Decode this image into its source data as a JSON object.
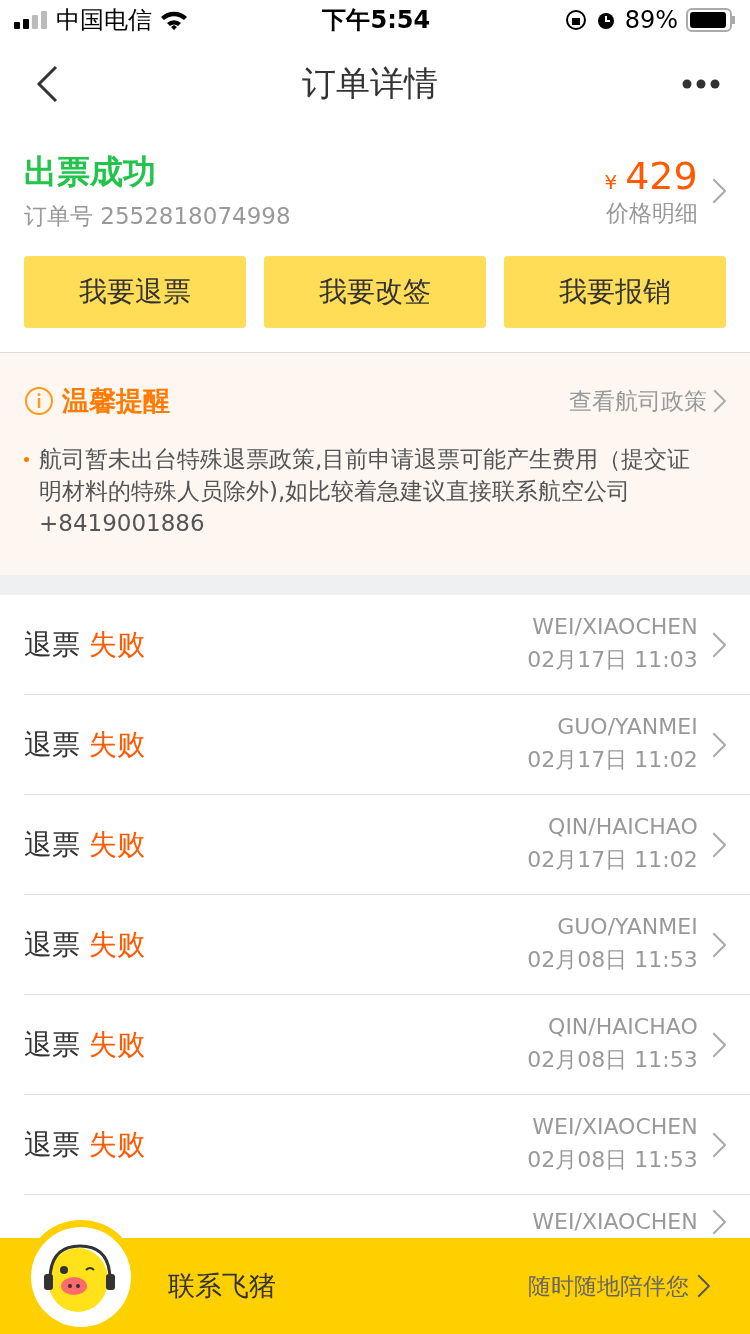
{
  "status_bar": {
    "carrier": "中国电信",
    "time": "下午5:54",
    "battery": "89%"
  },
  "nav": {
    "title": "订单详情"
  },
  "order": {
    "status": "出票成功",
    "order_number": "订单号 2552818074998",
    "currency": "¥",
    "price": "429",
    "price_link": "价格明细"
  },
  "actions": [
    "我要退票",
    "我要改签",
    "我要报销"
  ],
  "notice": {
    "title": "温馨提醒",
    "link": "查看航司政策",
    "body": "航司暂未出台特殊退票政策,目前申请退票可能产生费用（提交证明材料的特殊人员除外),如比较着急建议直接联系航空公司+8419001886"
  },
  "refunds": [
    {
      "label": "退票",
      "status": "失败",
      "name": "WEI/XIAOCHEN",
      "time": "02月17日 11:03"
    },
    {
      "label": "退票",
      "status": "失败",
      "name": "GUO/YANMEI",
      "time": "02月17日 11:02"
    },
    {
      "label": "退票",
      "status": "失败",
      "name": "QIN/HAICHAO",
      "time": "02月17日 11:02"
    },
    {
      "label": "退票",
      "status": "失败",
      "name": "GUO/YANMEI",
      "time": "02月08日 11:53"
    },
    {
      "label": "退票",
      "status": "失败",
      "name": "QIN/HAICHAO",
      "time": "02月08日 11:53"
    },
    {
      "label": "退票",
      "status": "失败",
      "name": "WEI/XIAOCHEN",
      "time": "02月08日 11:53"
    },
    {
      "name": "WEI/XIAOCHEN"
    }
  ],
  "contact_bar": {
    "label": "联系飞猪",
    "hint": "随时随地陪伴您"
  }
}
